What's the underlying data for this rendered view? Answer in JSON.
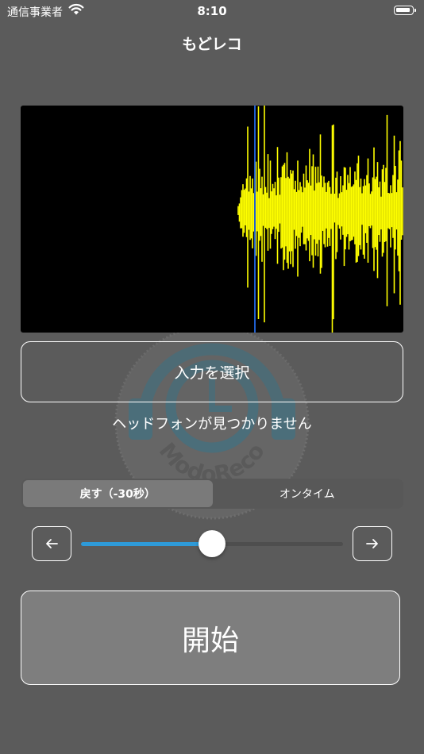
{
  "status_bar": {
    "carrier": "通信事業者",
    "time": "8:10"
  },
  "header": {
    "title": "もどレコ"
  },
  "watermark": {
    "text": "ModoReco"
  },
  "input_button": {
    "label": "入力を選択"
  },
  "status_message": "ヘッドフォンが見つかりません",
  "mode_control": {
    "segments": [
      {
        "label": "戻す（-30秒）",
        "selected": true
      },
      {
        "label": "オンタイム",
        "selected": false
      }
    ]
  },
  "rewind_slider": {
    "value": 0.5
  },
  "start_button": {
    "label": "開始"
  },
  "colors": {
    "background": "#5b5b5b",
    "waveform": "#ffff00",
    "playhead": "#1f5fd0",
    "slider_fill": "#2e9ad8"
  }
}
